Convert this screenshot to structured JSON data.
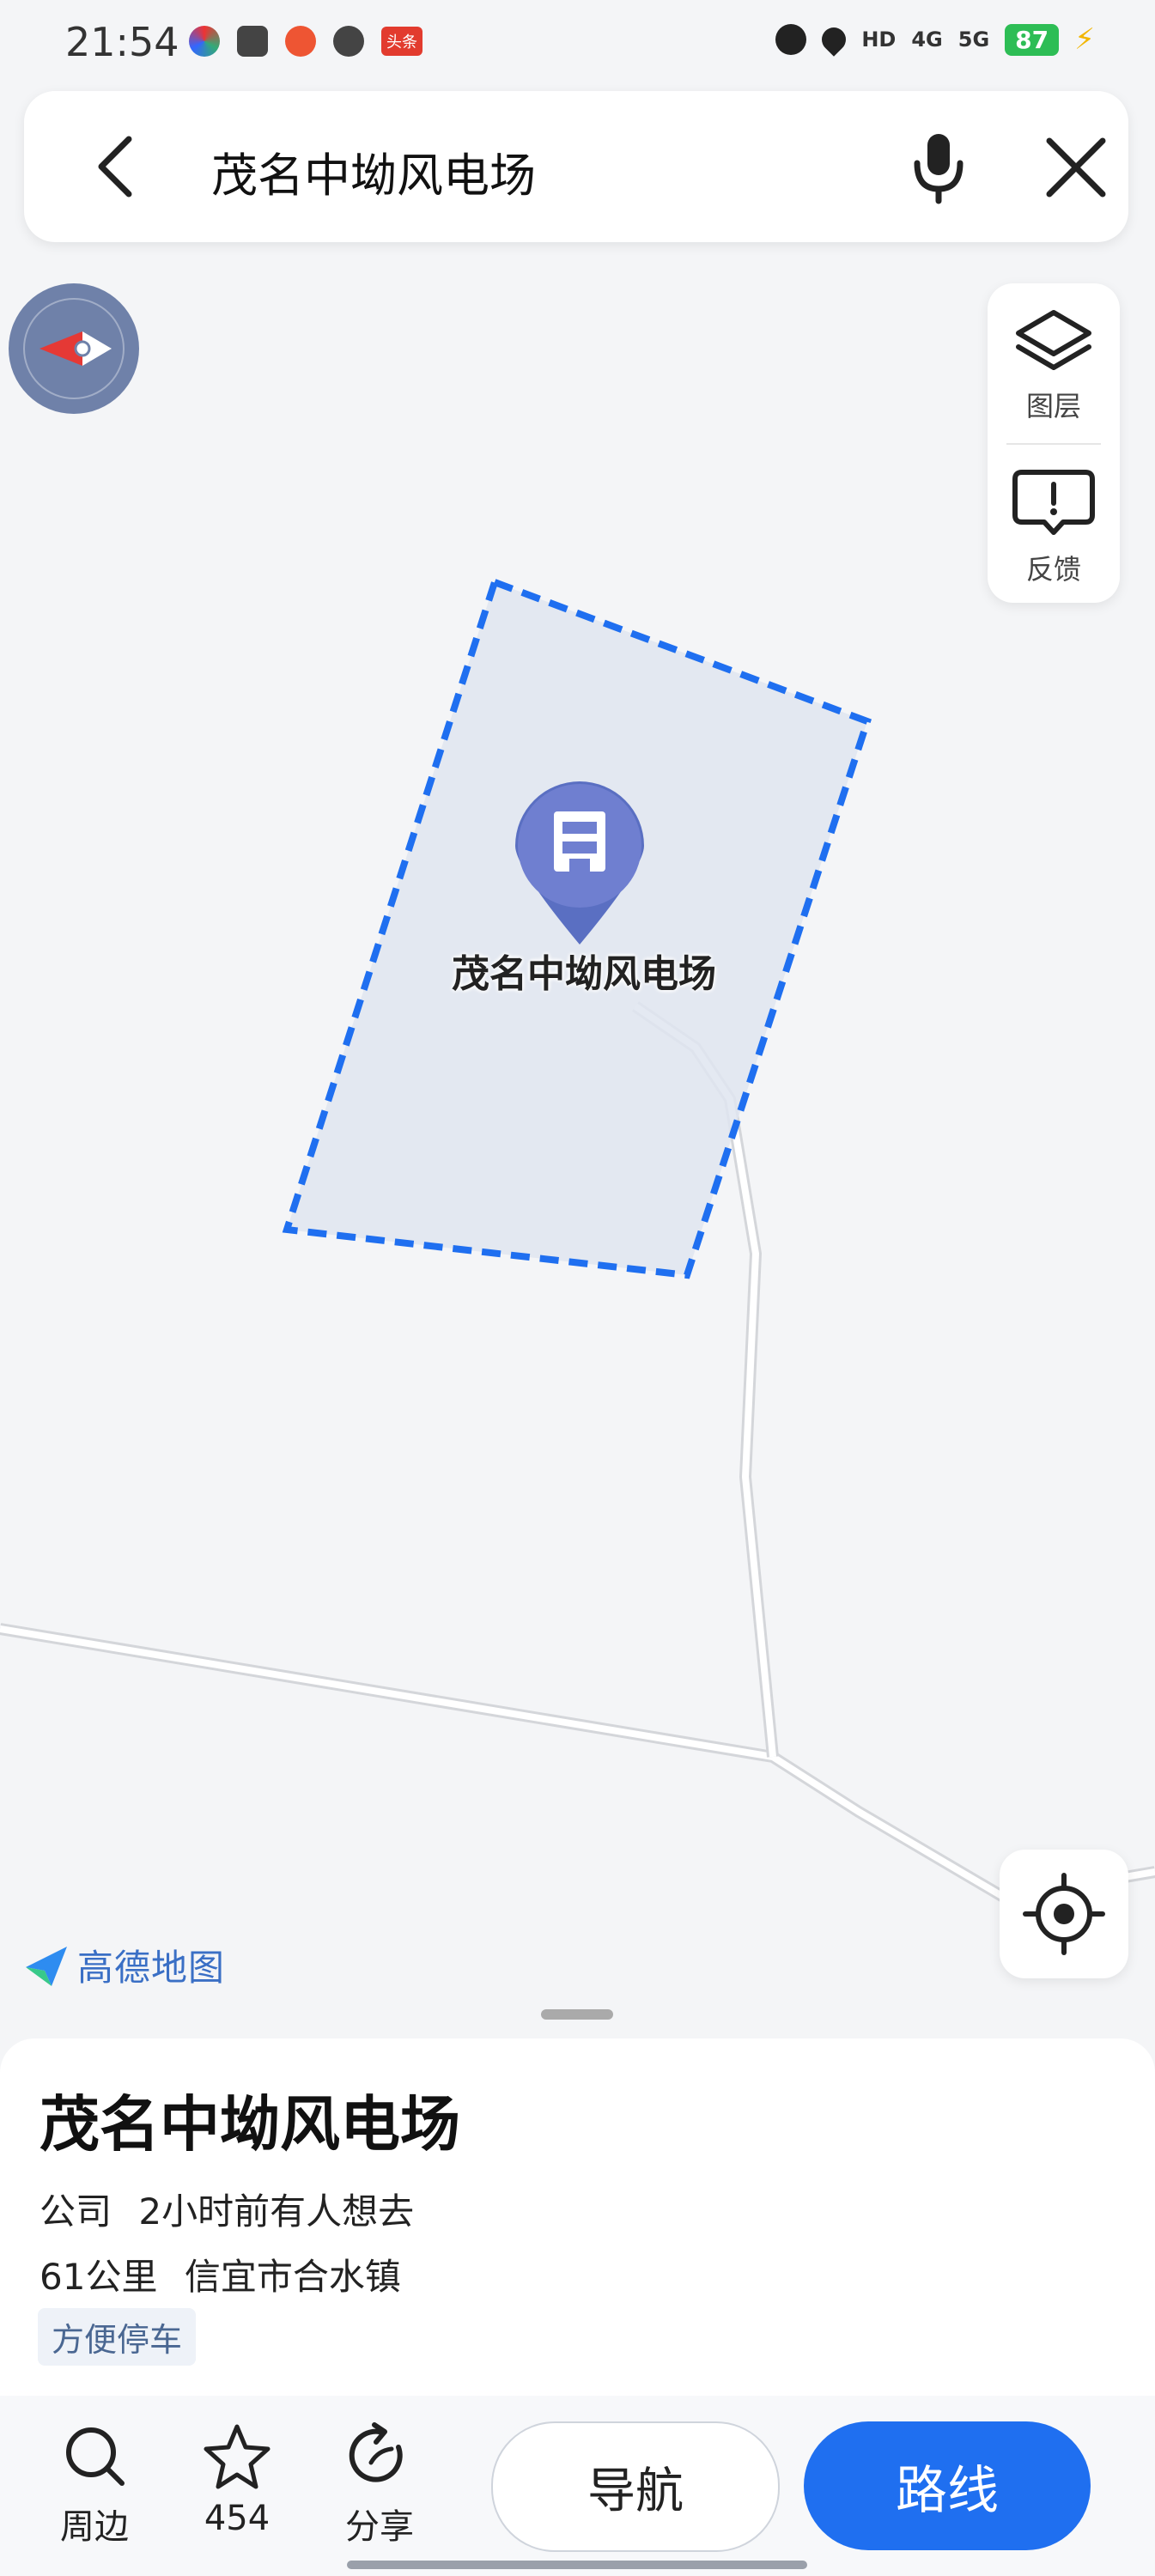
{
  "status": {
    "time": "21:54",
    "app_badge": "头条",
    "hd_label": "HD",
    "net_4g": "4G",
    "net_5g": "5G",
    "battery": "87"
  },
  "search": {
    "query": "茂名中坳风电场"
  },
  "map": {
    "layers_label": "图层",
    "feedback_label": "反馈",
    "pin_label": "茂名中坳风电场",
    "brand": "高德地图",
    "area_fill_color": "#dfe5f0",
    "area_border_color": "#1f6ff0",
    "pin_color": "#5a6fc2"
  },
  "poi": {
    "name": "茂名中坳风电场",
    "category": "公司",
    "visit_hint": "2小时前有人想去",
    "distance": "61公里",
    "address": "信宜市合水镇",
    "tag": "方便停车"
  },
  "actions": {
    "nearby_label": "周边",
    "favorite_count": "454",
    "share_label": "分享",
    "navigate_label": "导航",
    "route_label": "路线"
  },
  "colors": {
    "accent": "#1f6ff0",
    "battery": "#2dbd55"
  }
}
